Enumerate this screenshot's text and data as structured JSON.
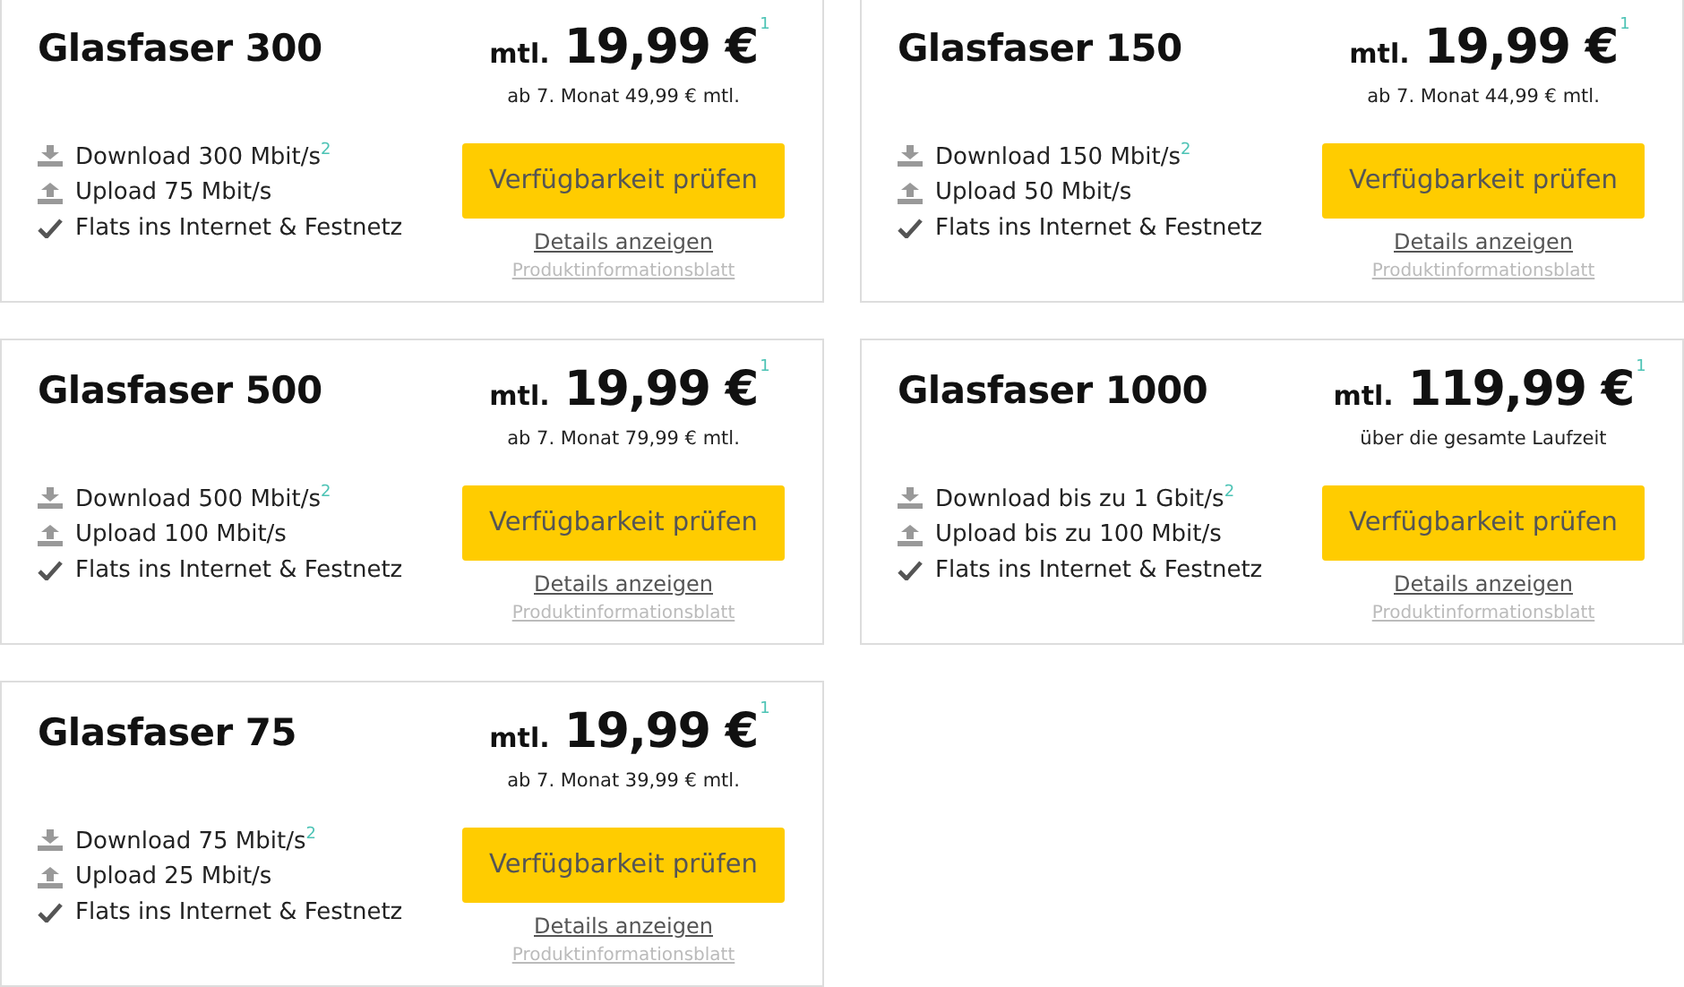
{
  "cards": [
    {
      "title": "Glasfaser 300",
      "price_prefix": "mtl.",
      "price": "19,99 €",
      "price_footnote": "1",
      "price_note": "ab 7. Monat 49,99 € mtl.",
      "features": [
        {
          "kind": "download",
          "text": "Download 300 Mbit/s$^{2}$"
        },
        {
          "kind": "upload",
          "text": "Upload 75 Mbit/s"
        },
        {
          "kind": "check",
          "text": "Flats ins Internet & Festnetz"
        }
      ],
      "button": "Verfügbarkeit prüfen",
      "details_link": "Details anzeigen",
      "info_link": "Produktinformationsblatt"
    },
    {
      "title": "Glasfaser 150",
      "price_prefix": "mtl.",
      "price": "19,99 €",
      "price_footnote": "1",
      "price_note": "ab 7. Monat 44,99 € mtl.",
      "features": [
        {
          "kind": "download",
          "text": "Download 150 Mbit/s$^{2}$"
        },
        {
          "kind": "upload",
          "text": "Upload 50 Mbit/s"
        },
        {
          "kind": "check",
          "text": "Flats ins Internet & Festnetz"
        }
      ],
      "button": "Verfügbarkeit prüfen",
      "details_link": "Details anzeigen",
      "info_link": "Produktinformationsblatt"
    },
    {
      "title": "Glasfaser 500",
      "price_prefix": "mtl.",
      "price": "19,99 €",
      "price_footnote": "1",
      "price_note": "ab 7. Monat 79,99 € mtl.",
      "features": [
        {
          "kind": "download",
          "text": "Download 500 Mbit/s$^{2}$"
        },
        {
          "kind": "upload",
          "text": "Upload 100 Mbit/s"
        },
        {
          "kind": "check",
          "text": "Flats ins Internet & Festnetz"
        }
      ],
      "button": "Verfügbarkeit prüfen",
      "details_link": "Details anzeigen",
      "info_link": "Produktinformationsblatt"
    },
    {
      "title": "Glasfaser 1000",
      "price_prefix": "mtl.",
      "price": "119,99 €",
      "price_footnote": "1",
      "price_note": "über die gesamte Laufzeit",
      "features": [
        {
          "kind": "download",
          "text": "Download bis zu 1 Gbit/s$^{2}$"
        },
        {
          "kind": "upload",
          "text": "Upload bis zu 100 Mbit/s"
        },
        {
          "kind": "check",
          "text": "Flats ins Internet & Festnetz"
        }
      ],
      "button": "Verfügbarkeit prüfen",
      "details_link": "Details anzeigen",
      "info_link": "Produktinformationsblatt"
    },
    {
      "title": "Glasfaser 75",
      "price_prefix": "mtl.",
      "price": "19,99 €",
      "price_footnote": "1",
      "price_note": "ab 7. Monat 39,99 € mtl.",
      "features": [
        {
          "kind": "download",
          "text": "Download 75 Mbit/s$^{2}$"
        },
        {
          "kind": "upload",
          "text": "Upload 25 Mbit/s"
        },
        {
          "kind": "check",
          "text": "Flats ins Internet & Festnetz"
        }
      ],
      "button": "Verfügbarkeit prüfen",
      "details_link": "Details anzeigen",
      "info_link": "Produktinformationsblatt"
    }
  ]
}
